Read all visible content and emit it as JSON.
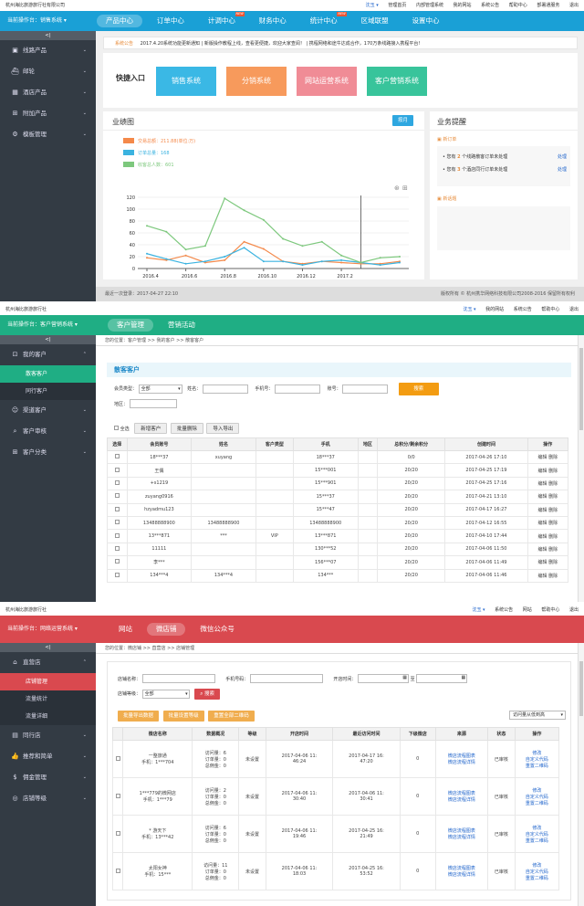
{
  "p1": {
    "title": "杭州海比旅游旅行社有限公司",
    "user": "沈玉 ▾",
    "links": [
      "管理首页",
      "内部管理系统",
      "我的网站",
      "系统公告",
      "帮助中心",
      "部署通服务",
      "退出"
    ],
    "who": "当前操作台：",
    "sys": "销售系统 ▾",
    "menu": [
      "产品中心",
      "订单中心",
      "计调中心",
      "财务中心",
      "统计中心",
      "区域联盟",
      "设置中心"
    ],
    "hot": "NEW",
    "side": [
      "线路产品",
      "邮轮",
      "酒店产品",
      "附加产品",
      "模板管理"
    ],
    "notice_label": "系统公告",
    "notice": "2017.4.20系统功能更新通知  |  新版操作教程上线，查看更便捷，欢迎大家查阅！  |  携程网络和途牛达成合作，170万条线路接入携程平台!",
    "quick_label": "快捷入口",
    "quick": [
      "销售系统",
      "分销系统",
      "网站运营系统",
      "客户营销系统"
    ],
    "quick_colors": [
      "#3ab8e5",
      "#f79a5c",
      "#f08c96",
      "#38c49b"
    ],
    "chart_title": "业绩图",
    "chart_btn": "按月",
    "chart_data": {
      "type": "line",
      "x": [
        "2016.4",
        "2016.6",
        "2016.8",
        "2016.10",
        "2016.12",
        "2017.2"
      ],
      "ylim": [
        0,
        120
      ],
      "yticks": [
        0,
        20,
        40,
        60,
        80,
        100,
        120
      ],
      "series": [
        {
          "name": "交易总额：211.88(单位:万)",
          "color": "#f4894a",
          "values": [
            18,
            14,
            22,
            10,
            14,
            45,
            33,
            12,
            8,
            12,
            10,
            8,
            8,
            12
          ]
        },
        {
          "name": "订单总量：168",
          "color": "#3bb3e0",
          "values": [
            25,
            16,
            8,
            12,
            20,
            35,
            12,
            12,
            6,
            12,
            14,
            10,
            6,
            10
          ]
        },
        {
          "name": "收客总人数：601",
          "color": "#7dc87d",
          "values": [
            72,
            62,
            32,
            38,
            118,
            98,
            82,
            50,
            38,
            45,
            22,
            10,
            18,
            20
          ]
        }
      ]
    },
    "biz_title": "业务提醒",
    "biz_new": "新订单",
    "biz": [
      {
        "pre": "您有",
        "n": "2",
        "post": "个线路散客订单未处理",
        "act": "处理"
      },
      {
        "pre": "您有",
        "n": "3",
        "post": "个酒店同行订单未处理",
        "act": "处理"
      }
    ],
    "biz_more": "新话题",
    "foot_left": "最近一次登录：2017-04-27 22:10",
    "foot_right": "版权所有 © 杭州携华网络科技有限公司2008-2016 保留所有权利"
  },
  "p2": {
    "title": "杭州海比旅游旅行社",
    "user": "沈玉 ▾",
    "links": [
      "我的网站",
      "系统公告",
      "帮助中心",
      "退出"
    ],
    "who": "当前操作台：",
    "sys": "客户营销系统 ▾",
    "menu": [
      "客户管理",
      "营销活动"
    ],
    "side": [
      {
        "t": "我的客户",
        "subs": [
          "散客客户",
          "同行客户"
        ]
      },
      {
        "t": "渠道客户"
      },
      {
        "t": "客户审核"
      },
      {
        "t": "客户分类"
      }
    ],
    "crumb": "您的位置：客户管理 >> 我的客户 >> 散客客户",
    "head": "散客客户",
    "f": {
      "type": "会员类型：",
      "type_val": "全部",
      "name": "姓名：",
      "phone": "手机号：",
      "acct": "账号：",
      "area": "地区：",
      "search": "搜索"
    },
    "acts": [
      "全选",
      "新增客户",
      "批量删除",
      "导入导出"
    ],
    "cols": [
      "选择",
      "会员账号",
      "姓名",
      "客户类型",
      "手机",
      "地区",
      "总积分/剩余积分",
      "创建时间",
      "操作"
    ],
    "rows": [
      [
        "18***37",
        "xuyang",
        "",
        "18***37",
        "",
        "0/0",
        "2017-04-26 17:10"
      ],
      [
        "王偶",
        "",
        "",
        "15***001",
        "",
        "20/20",
        "2017-04-25 17:19"
      ],
      [
        "+s1219",
        "",
        "",
        "15***901",
        "",
        "20/20",
        "2017-04-25 17:16"
      ],
      [
        "zuyang0916",
        "",
        "",
        "15***37",
        "",
        "20/20",
        "2017-04-21 13:10"
      ],
      [
        "hzyadmu123",
        "",
        "",
        "15***47",
        "",
        "20/20",
        "2017-04-17 16:27"
      ],
      [
        "13488888900",
        "13488888900",
        "",
        "13488888900",
        "",
        "20/20",
        "2017-04-12 16:55"
      ],
      [
        "13***871",
        "***",
        "VIP",
        "13***871",
        "",
        "20/20",
        "2017-04-10 17:44"
      ],
      [
        "11111",
        "",
        "",
        "130***52",
        "",
        "20/20",
        "2017-04-06 11:50"
      ],
      [
        "李***",
        "",
        "",
        "156***07",
        "",
        "20/20",
        "2017-04-06 11:49"
      ],
      [
        "134***4",
        "134***4",
        "",
        "134***",
        "",
        "20/20",
        "2017-04-06 11:46"
      ]
    ],
    "op": "编辑 删除"
  },
  "p3": {
    "title": "杭州海比旅游旅行社",
    "user": "沈玉 ▾",
    "links": [
      "系统公告",
      "网站",
      "帮助中心",
      "退出"
    ],
    "who": "当前操作台：",
    "sys": "网络运营系统 ▾",
    "menu": [
      "网站",
      "微店铺",
      "微信公众号"
    ],
    "side": [
      {
        "t": "直营店",
        "subs": [
          "店铺管理",
          "流量统计",
          "流量详细"
        ]
      },
      {
        "t": "同行店"
      },
      {
        "t": "推荐和简单"
      },
      {
        "t": "佣金管理"
      },
      {
        "t": "店铺等级"
      }
    ],
    "crumb": "您的位置：微店铺 >> 直营店 >> 店铺管理",
    "f": {
      "name": "店铺名称：",
      "phone": "手机号码：",
      "open": "开店时间：",
      "to": "至",
      "level": "店铺等级：",
      "level_val": "全部",
      "search": "搜索",
      "sort": "访问量从低到高"
    },
    "acts": [
      "批量导出数据",
      "批量设置等级",
      "重置全部二维码"
    ],
    "cols": [
      "",
      "微店名称",
      "数据概况",
      "等级",
      "开店时间",
      "最近访问时间",
      "下级微店",
      "来源",
      "状态",
      "操作"
    ],
    "rows": [
      {
        "n1": "一整旅通",
        "n2": "手机：1***704",
        "d": [
          "访问量：6",
          "订单量：0",
          "总佣金：0"
        ],
        "lv": "未设置",
        "o": [
          "2017-04-06 11:",
          "46:24"
        ],
        "v": [
          "2017-04-17 16:",
          "47:20"
        ],
        "s": "0",
        "src": [
          "微店流程图表",
          "微店流程详情"
        ],
        "st": "已审核",
        "op": [
          "修改",
          "自定义代码",
          "重置二维码"
        ]
      },
      {
        "n1": "1***779的微网店",
        "n2": "手机：1***79",
        "d": [
          "访问量：2",
          "订单量：0",
          "总佣金：0"
        ],
        "lv": "未设置",
        "o": [
          "2017-04-06 11:",
          "30:40"
        ],
        "v": [
          "2017-04-06 11:",
          "30:41"
        ],
        "s": "0",
        "src": [
          "微店流程图表",
          "微店流程详情"
        ],
        "st": "已审核",
        "op": [
          "修改",
          "自定义代码",
          "重置二维码"
        ]
      },
      {
        "n1": "* 游天下",
        "n2": "手机：13***42",
        "d": [
          "访问量：6",
          "订单量：0",
          "总佣金：0"
        ],
        "lv": "未设置",
        "o": [
          "2017-04-06 11:",
          "19:46"
        ],
        "v": [
          "2017-04-25 16:",
          "21:49"
        ],
        "s": "0",
        "src": [
          "微店流程图表",
          "微店流程详情"
        ],
        "st": "已审核",
        "op": [
          "修改",
          "自定义代码",
          "重置二维码"
        ]
      },
      {
        "n1": "太阳女神",
        "n2": "手机：15***",
        "d": [
          "访问量：11",
          "订单量：0",
          "总佣金：0"
        ],
        "lv": "未设置",
        "o": [
          "2017-04-06 11:",
          "18:03"
        ],
        "v": [
          "2017-04-25 16:",
          "53:52"
        ],
        "s": "0",
        "src": [
          "微店流程图表",
          "微店流程详情"
        ],
        "st": "已审核",
        "op": [
          "修改",
          "自定义代码",
          "重置二维码"
        ]
      }
    ]
  }
}
